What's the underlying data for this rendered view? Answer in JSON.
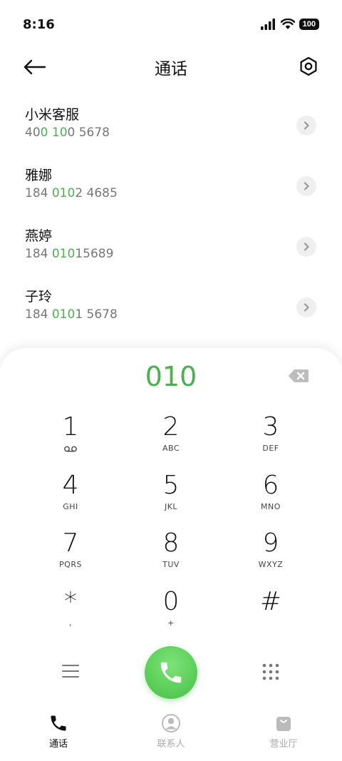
{
  "status_bar": {
    "time": "8:16",
    "battery": "100"
  },
  "header": {
    "title": "通话"
  },
  "contacts": [
    {
      "name": "小米客服",
      "number_parts": [
        "40",
        "0",
        " ",
        "10",
        "0 5678"
      ]
    },
    {
      "name": "雅娜",
      "number_parts": [
        "184 ",
        "010",
        "",
        "",
        "2 4685"
      ]
    },
    {
      "name": "燕婷",
      "number_parts": [
        "184 ",
        "010",
        "",
        "",
        "15689"
      ]
    },
    {
      "name": "子玲",
      "number_parts": [
        "184 ",
        "010",
        "",
        "",
        "1 5678"
      ]
    }
  ],
  "dialer": {
    "input_value": "010",
    "keys": [
      {
        "digit": "1",
        "letters": ""
      },
      {
        "digit": "2",
        "letters": "ABC"
      },
      {
        "digit": "3",
        "letters": "DEF"
      },
      {
        "digit": "4",
        "letters": "GHI"
      },
      {
        "digit": "5",
        "letters": "JKL"
      },
      {
        "digit": "6",
        "letters": "MNO"
      },
      {
        "digit": "7",
        "letters": "PQRS"
      },
      {
        "digit": "8",
        "letters": "TUV"
      },
      {
        "digit": "9",
        "letters": "WXYZ"
      },
      {
        "digit": "*",
        "letters": ","
      },
      {
        "digit": "0",
        "letters": "+"
      },
      {
        "digit": "#",
        "letters": ""
      }
    ]
  },
  "nav": {
    "calls": "通话",
    "contacts": "联系人",
    "store": "营业厅"
  },
  "colors": {
    "accent": "#4caf50",
    "call_button": "#45c144"
  }
}
